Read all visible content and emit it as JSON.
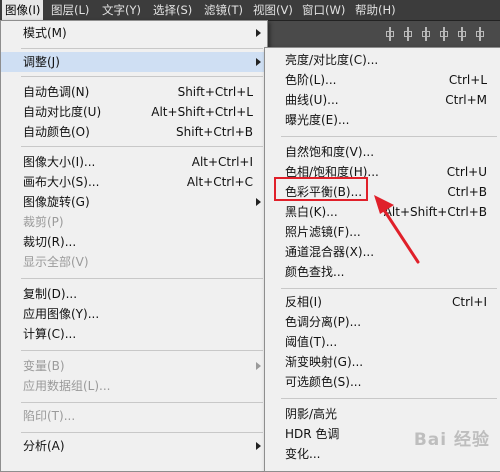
{
  "menubar": {
    "items": [
      {
        "label": "图像(I)",
        "active": true
      },
      {
        "label": "图层(L)"
      },
      {
        "label": "文字(Y)"
      },
      {
        "label": "选择(S)"
      },
      {
        "label": "滤镜(T)"
      },
      {
        "label": "视图(V)"
      },
      {
        "label": "窗口(W)"
      },
      {
        "label": "帮助(H)"
      }
    ]
  },
  "image_menu": {
    "items": [
      {
        "label": "模式(M)",
        "shortcut": "",
        "submenu": true
      },
      {
        "label": "调整(J)",
        "shortcut": "",
        "submenu": true,
        "highlighted": true
      },
      {
        "label": "自动色调(N)",
        "shortcut": "Shift+Ctrl+L"
      },
      {
        "label": "自动对比度(U)",
        "shortcut": "Alt+Shift+Ctrl+L"
      },
      {
        "label": "自动颜色(O)",
        "shortcut": "Shift+Ctrl+B"
      },
      {
        "label": "图像大小(I)...",
        "shortcut": "Alt+Ctrl+I"
      },
      {
        "label": "画布大小(S)...",
        "shortcut": "Alt+Ctrl+C"
      },
      {
        "label": "图像旋转(G)",
        "shortcut": "",
        "submenu": true
      },
      {
        "label": "裁剪(P)",
        "shortcut": "",
        "disabled": true
      },
      {
        "label": "裁切(R)...",
        "shortcut": ""
      },
      {
        "label": "显示全部(V)",
        "shortcut": "",
        "disabled": true
      },
      {
        "label": "复制(D)...",
        "shortcut": ""
      },
      {
        "label": "应用图像(Y)...",
        "shortcut": ""
      },
      {
        "label": "计算(C)...",
        "shortcut": ""
      },
      {
        "label": "变量(B)",
        "shortcut": "",
        "submenu": true,
        "disabled": true
      },
      {
        "label": "应用数据组(L)...",
        "shortcut": "",
        "disabled": true
      },
      {
        "label": "陷印(T)...",
        "shortcut": "",
        "disabled": true
      },
      {
        "label": "分析(A)",
        "shortcut": "",
        "submenu": true
      }
    ]
  },
  "adjust_menu": {
    "items": [
      {
        "label": "亮度/对比度(C)...",
        "shortcut": ""
      },
      {
        "label": "色阶(L)...",
        "shortcut": "Ctrl+L"
      },
      {
        "label": "曲线(U)...",
        "shortcut": "Ctrl+M"
      },
      {
        "label": "曝光度(E)...",
        "shortcut": ""
      },
      {
        "label": "自然饱和度(V)...",
        "shortcut": ""
      },
      {
        "label": "色相/饱和度(H)...",
        "shortcut": "Ctrl+U"
      },
      {
        "label": "色彩平衡(B)...",
        "shortcut": "Ctrl+B"
      },
      {
        "label": "黑白(K)...",
        "shortcut": "Alt+Shift+Ctrl+B"
      },
      {
        "label": "照片滤镜(F)...",
        "shortcut": ""
      },
      {
        "label": "通道混合器(X)...",
        "shortcut": ""
      },
      {
        "label": "颜色查找...",
        "shortcut": ""
      },
      {
        "label": "反相(I)",
        "shortcut": "Ctrl+I"
      },
      {
        "label": "色调分离(P)...",
        "shortcut": ""
      },
      {
        "label": "阈值(T)...",
        "shortcut": ""
      },
      {
        "label": "渐变映射(G)...",
        "shortcut": ""
      },
      {
        "label": "可选颜色(S)...",
        "shortcut": ""
      },
      {
        "label": "阴影/高光",
        "shortcut": ""
      },
      {
        "label": "HDR 色调",
        "shortcut": ""
      },
      {
        "label": "变化...",
        "shortcut": ""
      }
    ]
  },
  "annotation": {
    "color": "#e0202a",
    "target": "色彩平衡(B)..."
  },
  "watermark": {
    "text": "Bai 经验"
  }
}
